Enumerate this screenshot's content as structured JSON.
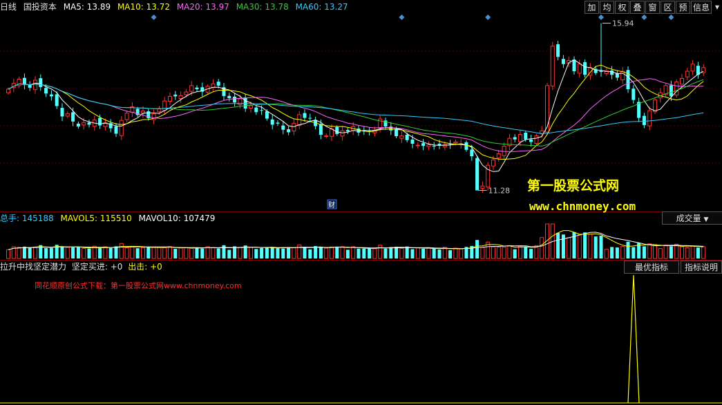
{
  "header": {
    "period": "日线",
    "stock": "国投资本",
    "ma": [
      {
        "label": "MA5: 13.89",
        "color": "#ffffff"
      },
      {
        "label": "MA10: 13.72",
        "color": "#ffff00"
      },
      {
        "label": "MA20: 13.97",
        "color": "#ff66ff"
      },
      {
        "label": "MA30: 13.78",
        "color": "#33cc33"
      },
      {
        "label": "MA60: 13.27",
        "color": "#33ccff"
      }
    ]
  },
  "toolbar": [
    "加",
    "均",
    "权",
    "叠",
    "窗",
    "区",
    "预",
    "信息",
    "▾"
  ],
  "volume_header": {
    "total": {
      "label": "总手: 145188",
      "color": "#33ccff"
    },
    "mavol5": {
      "label": "MAVOL5: 115510",
      "color": "#ffff00"
    },
    "mavol10": {
      "label": "MAVOL10: 107479",
      "color": "#ffffff"
    },
    "dropdown": "成交量"
  },
  "indicator_header": {
    "title": "拉升中找坚定潜力",
    "buy": "坚定买进: +0",
    "sell": "出击: +0",
    "btn_best": "最优指标",
    "btn_explain": "指标说明"
  },
  "annotations": {
    "high_price": "15.94",
    "low_price": "11.28",
    "finance_marker": "财",
    "watermark_cn": "第一股票公式网",
    "watermark_url": "www.chnmoney.com",
    "note": "同花顺原创公式下载：第一股票公式网www.chnmoney.com"
  },
  "colors": {
    "up": "#ff3333",
    "down": "#54ffff",
    "grid": "#7a0000",
    "diamond": "#4a8fd8"
  },
  "chart_data": {
    "type": "candlestick",
    "ylim": [
      11.0,
      16.2
    ],
    "high_point": {
      "index": 110,
      "price": 15.94
    },
    "low_point": {
      "index": 87,
      "price": 11.28
    },
    "closes": [
      14.1,
      14.26,
      14.38,
      14.22,
      14.14,
      14.35,
      14.16,
      13.98,
      13.9,
      13.63,
      13.34,
      13.42,
      13.2,
      13.06,
      13.17,
      13.11,
      13.24,
      13.09,
      13.17,
      13.01,
      12.86,
      13.23,
      13.43,
      13.61,
      13.38,
      13.49,
      13.29,
      13.41,
      13.55,
      13.77,
      13.9,
      13.9,
      13.92,
      14.02,
      14.2,
      14.1,
      14.03,
      14.18,
      14.25,
      14.2,
      13.91,
      13.85,
      13.73,
      13.83,
      13.56,
      13.64,
      13.46,
      13.51,
      13.28,
      13.11,
      13.14,
      12.97,
      12.9,
      13.15,
      13.39,
      13.3,
      13.29,
      13.07,
      12.83,
      12.8,
      12.99,
      12.85,
      12.94,
      12.92,
      13.06,
      12.89,
      12.94,
      12.92,
      12.96,
      13.27,
      13.06,
      12.95,
      12.79,
      12.8,
      12.68,
      12.58,
      12.54,
      12.52,
      12.55,
      12.52,
      12.54,
      12.56,
      12.56,
      12.63,
      12.58,
      12.41,
      12.23,
      11.28,
      11.4,
      11.98,
      12.13,
      12.3,
      12.51,
      12.73,
      12.7,
      12.84,
      12.7,
      12.63,
      12.8,
      12.94,
      14.2,
      15.3,
      15.0,
      14.8,
      14.9,
      14.6,
      14.8,
      14.5,
      14.7,
      14.55,
      14.58,
      14.62,
      14.5,
      14.42,
      14.6,
      14.1,
      13.8,
      13.3,
      13.1,
      13.5,
      13.8,
      14.0,
      14.2,
      13.9,
      14.3,
      14.4,
      14.6,
      14.8,
      14.5,
      14.7
    ],
    "volume_header_values": {
      "total": 145188,
      "mavol5": 115510,
      "mavol10": 107479
    },
    "signal": {
      "index": 115
    }
  }
}
